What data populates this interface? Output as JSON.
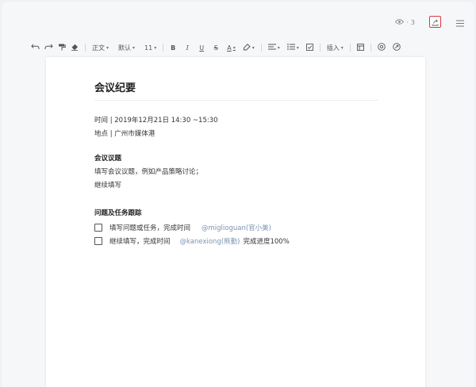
{
  "header": {
    "viewer_count": "3",
    "icons": [
      "eye-icon",
      "share-icon",
      "menu-icon"
    ]
  },
  "toolbar": {
    "style_label": "正文",
    "font_label": "默认",
    "size_label": "11",
    "insert_label": "插入",
    "icons": [
      "undo-icon",
      "redo-icon",
      "format-painter-icon",
      "clear-format-icon",
      "bold-icon",
      "italic-icon",
      "underline-icon",
      "strikethrough-icon",
      "text-color-icon",
      "highlight-icon",
      "align-icon",
      "list-icon",
      "checklist-icon",
      "template-icon",
      "mention-icon",
      "comment-icon"
    ],
    "bold_glyph": "B",
    "italic_glyph": "I",
    "underline_glyph": "U",
    "strike_glyph": "S",
    "color_glyph": "A",
    "accent_color": "#d9363e"
  },
  "document": {
    "title": "会议纪要",
    "time_line": "时间 | 2019年12月21日  14:30 ~15:30",
    "place_line": "地点 | 广州市媒体港",
    "agenda_heading": "会议议题",
    "agenda_lines": [
      "填写会议议题，例如产品策略讨论；",
      "继续填写"
    ],
    "tasks_heading": "问题及任务跟踪",
    "tasks": [
      {
        "text": "填写问题或任务，完成时间",
        "mention": "@miglioguan(官小美)",
        "after": ""
      },
      {
        "text": "继续填写，完成时间",
        "mention": "@kanexiong(熊勤)",
        "after": "完成进度100%"
      }
    ],
    "mention_color": "#7b93b3"
  }
}
